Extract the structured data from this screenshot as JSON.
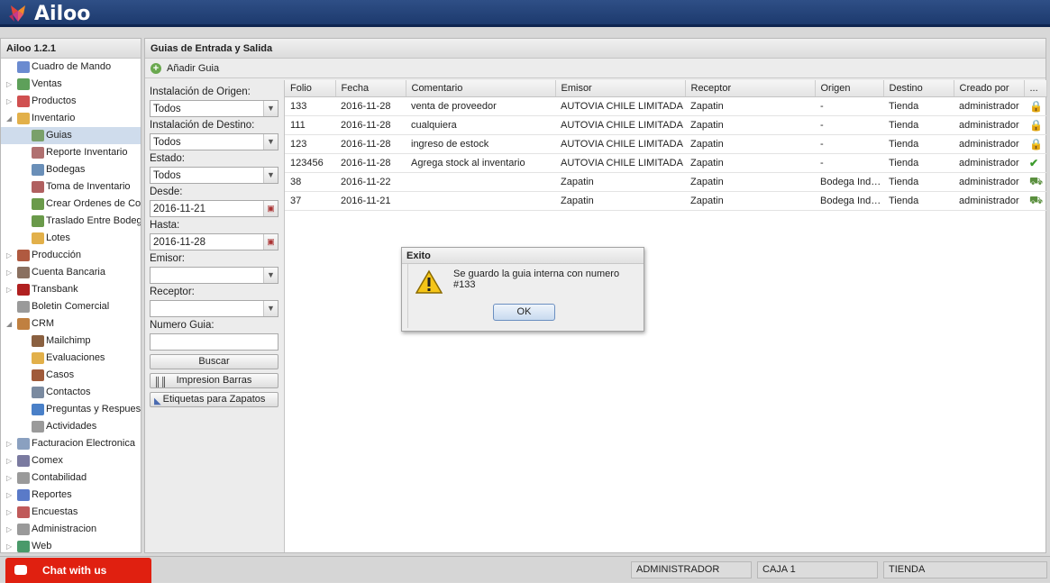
{
  "app": {
    "name": "Ailoo",
    "version": "Ailoo 1.2.1"
  },
  "sidebar": {
    "items": [
      {
        "label": "Cuadro de Mando",
        "level": 0,
        "arrow": "",
        "icon": "dashboard-icon",
        "color": "#6b8bd0"
      },
      {
        "label": "Ventas",
        "level": 0,
        "arrow": "▷",
        "icon": "tag-icon",
        "color": "#5ea05a"
      },
      {
        "label": "Productos",
        "level": 0,
        "arrow": "▷",
        "icon": "chart-icon",
        "color": "#d05050"
      },
      {
        "label": "Inventario",
        "level": 0,
        "arrow": "◢",
        "icon": "box-icon",
        "color": "#e2b04a"
      },
      {
        "label": "Guias",
        "level": 1,
        "arrow": "",
        "icon": "document-icon",
        "color": "#7aa06a",
        "selected": true
      },
      {
        "label": "Reporte Inventario",
        "level": 1,
        "arrow": "",
        "icon": "report-icon",
        "color": "#b07070"
      },
      {
        "label": "Bodegas",
        "level": 1,
        "arrow": "",
        "icon": "warehouse-icon",
        "color": "#6a8fb8"
      },
      {
        "label": "Toma de Inventario",
        "level": 1,
        "arrow": "",
        "icon": "clipboard-icon",
        "color": "#b06060"
      },
      {
        "label": "Crear Ordenes de Compra",
        "level": 1,
        "arrow": "",
        "icon": "truck-icon",
        "color": "#6a9a4a"
      },
      {
        "label": "Traslado Entre Bodegas",
        "level": 1,
        "arrow": "",
        "icon": "truck-icon",
        "color": "#6a9a4a"
      },
      {
        "label": "Lotes",
        "level": 1,
        "arrow": "",
        "icon": "box-icon",
        "color": "#e2b04a"
      },
      {
        "label": "Producción",
        "level": 0,
        "arrow": "▷",
        "icon": "factory-icon",
        "color": "#b05a40"
      },
      {
        "label": "Cuenta Bancaria",
        "level": 0,
        "arrow": "▷",
        "icon": "bank-icon",
        "color": "#8a7060"
      },
      {
        "label": "Transbank",
        "level": 0,
        "arrow": "▷",
        "icon": "transbank-icon",
        "color": "#b02020"
      },
      {
        "label": "Boletin Comercial",
        "level": 0,
        "arrow": "",
        "icon": "tag-icon",
        "color": "#9a9a9a"
      },
      {
        "label": "CRM",
        "level": 0,
        "arrow": "◢",
        "icon": "people-icon",
        "color": "#c08040"
      },
      {
        "label": "Mailchimp",
        "level": 1,
        "arrow": "",
        "icon": "mailchimp-icon",
        "color": "#8a6040"
      },
      {
        "label": "Evaluaciones",
        "level": 1,
        "arrow": "",
        "icon": "folder-icon",
        "color": "#e2b04a"
      },
      {
        "label": "Casos",
        "level": 1,
        "arrow": "",
        "icon": "briefcase-icon",
        "color": "#a05a3a"
      },
      {
        "label": "Contactos",
        "level": 1,
        "arrow": "",
        "icon": "contacts-icon",
        "color": "#7a8aa0"
      },
      {
        "label": "Preguntas y Respuestas",
        "level": 1,
        "arrow": "",
        "icon": "help-icon",
        "color": "#4a80c8"
      },
      {
        "label": "Actividades",
        "level": 1,
        "arrow": "",
        "icon": "tag-icon",
        "color": "#9a9a9a"
      },
      {
        "label": "Facturacion Electronica",
        "level": 0,
        "arrow": "▷",
        "icon": "invoice-icon",
        "color": "#8aa0c0"
      },
      {
        "label": "Comex",
        "level": 0,
        "arrow": "▷",
        "icon": "truck-icon",
        "color": "#7a7aa0"
      },
      {
        "label": "Contabilidad",
        "level": 0,
        "arrow": "▷",
        "icon": "ledger-icon",
        "color": "#9a9a9a"
      },
      {
        "label": "Reportes",
        "level": 0,
        "arrow": "▷",
        "icon": "bar-chart-icon",
        "color": "#5a7ac8"
      },
      {
        "label": "Encuestas",
        "level": 0,
        "arrow": "▷",
        "icon": "survey-icon",
        "color": "#c05a5a"
      },
      {
        "label": "Administracion",
        "level": 0,
        "arrow": "▷",
        "icon": "gear-icon",
        "color": "#9a9a9a"
      },
      {
        "label": "Web",
        "level": 0,
        "arrow": "▷",
        "icon": "globe-icon",
        "color": "#4a9a6a"
      }
    ]
  },
  "main": {
    "title": "Guias de Entrada y Salida",
    "add_label": "Añadir Guia"
  },
  "filters": {
    "origen_label": "Instalación de Origen:",
    "origen_value": "Todos",
    "destino_label": "Instalación de Destino:",
    "destino_value": "Todos",
    "estado_label": "Estado:",
    "estado_value": "Todos",
    "desde_label": "Desde:",
    "desde_value": "2016-11-21",
    "hasta_label": "Hasta:",
    "hasta_value": "2016-11-28",
    "emisor_label": "Emisor:",
    "emisor_value": "",
    "receptor_label": "Receptor:",
    "receptor_value": "",
    "numero_label": "Numero Guia:",
    "numero_value": "",
    "buscar_label": "Buscar",
    "impresion_label": "Impresion Barras",
    "etiquetas_label": "Etiquetas para Zapatos"
  },
  "table": {
    "columns": [
      "Folio",
      "Fecha",
      "Comentario",
      "Emisor",
      "Receptor",
      "Origen",
      "Destino",
      "Creado por",
      "..."
    ],
    "rows": [
      {
        "folio": "133",
        "fecha": "2016-11-28",
        "comentario": "venta de proveedor",
        "emisor": "AUTOVIA CHILE LIMITADA",
        "receptor": "Zapatin",
        "origen": "-",
        "destino": "Tienda",
        "creado_por": "administrador",
        "status_icon": "lock-icon"
      },
      {
        "folio": "111",
        "fecha": "2016-11-28",
        "comentario": "cualquiera",
        "emisor": "AUTOVIA CHILE LIMITADA",
        "receptor": "Zapatin",
        "origen": "-",
        "destino": "Tienda",
        "creado_por": "administrador",
        "status_icon": "lock-icon"
      },
      {
        "folio": "123",
        "fecha": "2016-11-28",
        "comentario": "ingreso de estock",
        "emisor": "AUTOVIA CHILE LIMITADA",
        "receptor": "Zapatin",
        "origen": "-",
        "destino": "Tienda",
        "creado_por": "administrador",
        "status_icon": "lock-icon"
      },
      {
        "folio": "123456",
        "fecha": "2016-11-28",
        "comentario": "Agrega stock al inventario",
        "emisor": "AUTOVIA CHILE LIMITADA",
        "receptor": "Zapatin",
        "origen": "-",
        "destino": "Tienda",
        "creado_por": "administrador",
        "status_icon": "check-icon"
      },
      {
        "folio": "38",
        "fecha": "2016-11-22",
        "comentario": "",
        "emisor": "Zapatin",
        "receptor": "Zapatin",
        "origen": "Bodega Indep…",
        "destino": "Tienda",
        "creado_por": "administrador",
        "status_icon": "truck-icon"
      },
      {
        "folio": "37",
        "fecha": "2016-11-21",
        "comentario": "",
        "emisor": "Zapatin",
        "receptor": "Zapatin",
        "origen": "Bodega Indep…",
        "destino": "Tienda",
        "creado_por": "administrador",
        "status_icon": "truck-icon"
      }
    ]
  },
  "dialog": {
    "title": "Exito",
    "message": "Se guardo la guia interna con numero #133",
    "ok_label": "OK"
  },
  "statusbar": {
    "chat_label": "Chat with us",
    "user": "ADMINISTRADOR",
    "caja": "CAJA 1",
    "tienda": "TIENDA"
  },
  "colors": {
    "header": "#2f4f86",
    "chat": "#e02010",
    "selected": "#cfdcec"
  }
}
